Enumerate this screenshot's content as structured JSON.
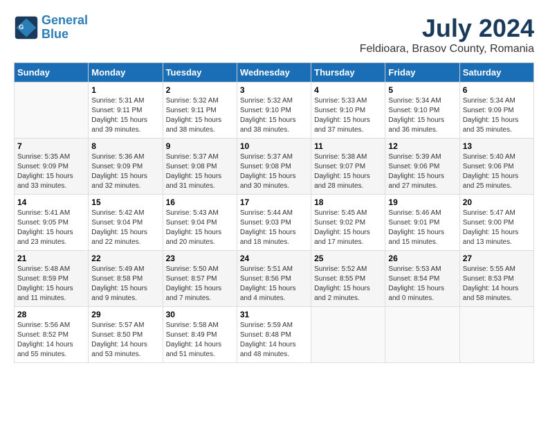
{
  "logo": {
    "line1": "General",
    "line2": "Blue"
  },
  "title": "July 2024",
  "subtitle": "Feldioara, Brasov County, Romania",
  "days_of_week": [
    "Sunday",
    "Monday",
    "Tuesday",
    "Wednesday",
    "Thursday",
    "Friday",
    "Saturday"
  ],
  "weeks": [
    [
      {
        "day": "",
        "sunrise": "",
        "sunset": "",
        "daylight": ""
      },
      {
        "day": "1",
        "sunrise": "Sunrise: 5:31 AM",
        "sunset": "Sunset: 9:11 PM",
        "daylight": "Daylight: 15 hours and 39 minutes."
      },
      {
        "day": "2",
        "sunrise": "Sunrise: 5:32 AM",
        "sunset": "Sunset: 9:11 PM",
        "daylight": "Daylight: 15 hours and 38 minutes."
      },
      {
        "day": "3",
        "sunrise": "Sunrise: 5:32 AM",
        "sunset": "Sunset: 9:10 PM",
        "daylight": "Daylight: 15 hours and 38 minutes."
      },
      {
        "day": "4",
        "sunrise": "Sunrise: 5:33 AM",
        "sunset": "Sunset: 9:10 PM",
        "daylight": "Daylight: 15 hours and 37 minutes."
      },
      {
        "day": "5",
        "sunrise": "Sunrise: 5:34 AM",
        "sunset": "Sunset: 9:10 PM",
        "daylight": "Daylight: 15 hours and 36 minutes."
      },
      {
        "day": "6",
        "sunrise": "Sunrise: 5:34 AM",
        "sunset": "Sunset: 9:09 PM",
        "daylight": "Daylight: 15 hours and 35 minutes."
      }
    ],
    [
      {
        "day": "7",
        "sunrise": "Sunrise: 5:35 AM",
        "sunset": "Sunset: 9:09 PM",
        "daylight": "Daylight: 15 hours and 33 minutes."
      },
      {
        "day": "8",
        "sunrise": "Sunrise: 5:36 AM",
        "sunset": "Sunset: 9:09 PM",
        "daylight": "Daylight: 15 hours and 32 minutes."
      },
      {
        "day": "9",
        "sunrise": "Sunrise: 5:37 AM",
        "sunset": "Sunset: 9:08 PM",
        "daylight": "Daylight: 15 hours and 31 minutes."
      },
      {
        "day": "10",
        "sunrise": "Sunrise: 5:37 AM",
        "sunset": "Sunset: 9:08 PM",
        "daylight": "Daylight: 15 hours and 30 minutes."
      },
      {
        "day": "11",
        "sunrise": "Sunrise: 5:38 AM",
        "sunset": "Sunset: 9:07 PM",
        "daylight": "Daylight: 15 hours and 28 minutes."
      },
      {
        "day": "12",
        "sunrise": "Sunrise: 5:39 AM",
        "sunset": "Sunset: 9:06 PM",
        "daylight": "Daylight: 15 hours and 27 minutes."
      },
      {
        "day": "13",
        "sunrise": "Sunrise: 5:40 AM",
        "sunset": "Sunset: 9:06 PM",
        "daylight": "Daylight: 15 hours and 25 minutes."
      }
    ],
    [
      {
        "day": "14",
        "sunrise": "Sunrise: 5:41 AM",
        "sunset": "Sunset: 9:05 PM",
        "daylight": "Daylight: 15 hours and 23 minutes."
      },
      {
        "day": "15",
        "sunrise": "Sunrise: 5:42 AM",
        "sunset": "Sunset: 9:04 PM",
        "daylight": "Daylight: 15 hours and 22 minutes."
      },
      {
        "day": "16",
        "sunrise": "Sunrise: 5:43 AM",
        "sunset": "Sunset: 9:04 PM",
        "daylight": "Daylight: 15 hours and 20 minutes."
      },
      {
        "day": "17",
        "sunrise": "Sunrise: 5:44 AM",
        "sunset": "Sunset: 9:03 PM",
        "daylight": "Daylight: 15 hours and 18 minutes."
      },
      {
        "day": "18",
        "sunrise": "Sunrise: 5:45 AM",
        "sunset": "Sunset: 9:02 PM",
        "daylight": "Daylight: 15 hours and 17 minutes."
      },
      {
        "day": "19",
        "sunrise": "Sunrise: 5:46 AM",
        "sunset": "Sunset: 9:01 PM",
        "daylight": "Daylight: 15 hours and 15 minutes."
      },
      {
        "day": "20",
        "sunrise": "Sunrise: 5:47 AM",
        "sunset": "Sunset: 9:00 PM",
        "daylight": "Daylight: 15 hours and 13 minutes."
      }
    ],
    [
      {
        "day": "21",
        "sunrise": "Sunrise: 5:48 AM",
        "sunset": "Sunset: 8:59 PM",
        "daylight": "Daylight: 15 hours and 11 minutes."
      },
      {
        "day": "22",
        "sunrise": "Sunrise: 5:49 AM",
        "sunset": "Sunset: 8:58 PM",
        "daylight": "Daylight: 15 hours and 9 minutes."
      },
      {
        "day": "23",
        "sunrise": "Sunrise: 5:50 AM",
        "sunset": "Sunset: 8:57 PM",
        "daylight": "Daylight: 15 hours and 7 minutes."
      },
      {
        "day": "24",
        "sunrise": "Sunrise: 5:51 AM",
        "sunset": "Sunset: 8:56 PM",
        "daylight": "Daylight: 15 hours and 4 minutes."
      },
      {
        "day": "25",
        "sunrise": "Sunrise: 5:52 AM",
        "sunset": "Sunset: 8:55 PM",
        "daylight": "Daylight: 15 hours and 2 minutes."
      },
      {
        "day": "26",
        "sunrise": "Sunrise: 5:53 AM",
        "sunset": "Sunset: 8:54 PM",
        "daylight": "Daylight: 15 hours and 0 minutes."
      },
      {
        "day": "27",
        "sunrise": "Sunrise: 5:55 AM",
        "sunset": "Sunset: 8:53 PM",
        "daylight": "Daylight: 14 hours and 58 minutes."
      }
    ],
    [
      {
        "day": "28",
        "sunrise": "Sunrise: 5:56 AM",
        "sunset": "Sunset: 8:52 PM",
        "daylight": "Daylight: 14 hours and 55 minutes."
      },
      {
        "day": "29",
        "sunrise": "Sunrise: 5:57 AM",
        "sunset": "Sunset: 8:50 PM",
        "daylight": "Daylight: 14 hours and 53 minutes."
      },
      {
        "day": "30",
        "sunrise": "Sunrise: 5:58 AM",
        "sunset": "Sunset: 8:49 PM",
        "daylight": "Daylight: 14 hours and 51 minutes."
      },
      {
        "day": "31",
        "sunrise": "Sunrise: 5:59 AM",
        "sunset": "Sunset: 8:48 PM",
        "daylight": "Daylight: 14 hours and 48 minutes."
      },
      {
        "day": "",
        "sunrise": "",
        "sunset": "",
        "daylight": ""
      },
      {
        "day": "",
        "sunrise": "",
        "sunset": "",
        "daylight": ""
      },
      {
        "day": "",
        "sunrise": "",
        "sunset": "",
        "daylight": ""
      }
    ]
  ]
}
